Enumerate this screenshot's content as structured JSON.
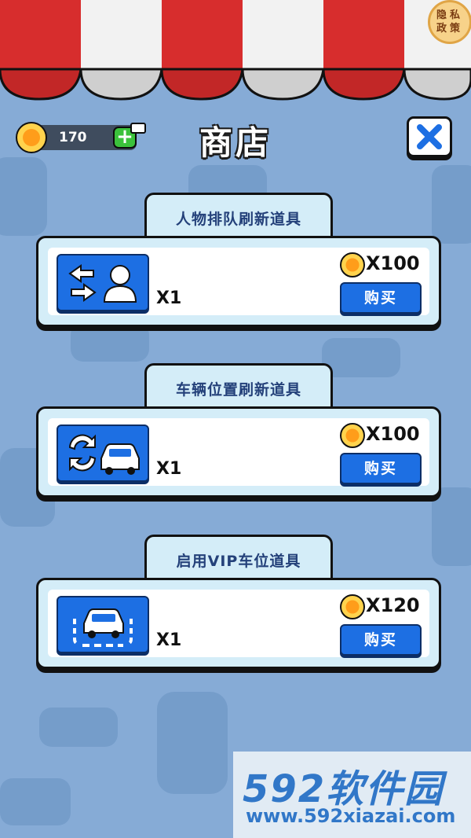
{
  "privacy": {
    "line1": "隐私",
    "line2": "政策"
  },
  "wallet": {
    "coins": "170",
    "add_label": "+"
  },
  "title": "商店",
  "items": [
    {
      "tab": "人物排队刷新道具",
      "qty": "X1",
      "price": "X100",
      "buy": "购买",
      "icon": "swap-person-icon"
    },
    {
      "tab": "车辆位置刷新道具",
      "qty": "X1",
      "price": "X100",
      "buy": "购买",
      "icon": "refresh-car-icon"
    },
    {
      "tab": "启用VIP车位道具",
      "qty": "X1",
      "price": "X120",
      "buy": "购买",
      "icon": "vip-parking-icon"
    }
  ],
  "watermark": {
    "brand": "592软件园",
    "url": "www.592xiazai.com"
  },
  "colors": {
    "background": "#86abd6",
    "awning_red": "#d72d2d",
    "awning_white": "#f2f2f2",
    "button_blue": "#1d6fe3"
  }
}
